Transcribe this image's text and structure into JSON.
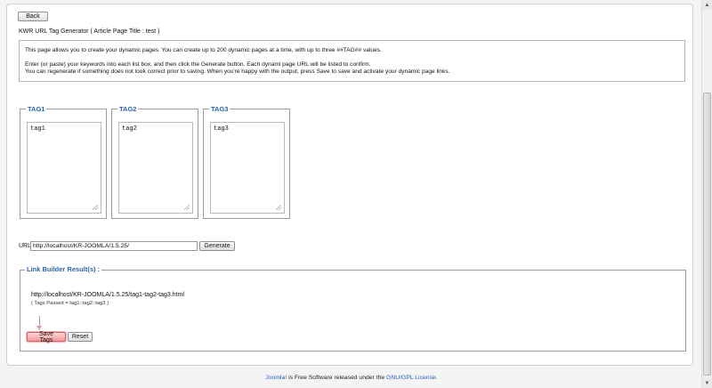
{
  "toolbar": {
    "back_label": "Back"
  },
  "page": {
    "title": "KWR URL Tag Generator ( Article Page Title : test )"
  },
  "info": {
    "line1": "This page allows you to create your dynamic pages. You can create up to 200 dynamic pages at a time, with up to three ##TAG## values.",
    "line2": "Enter (or paste) your keywords into each list box, and then click the Generate button. Each dynami page URL will be listed to confirm.",
    "line3": "You can regenerate if something does not look correct prior to saving. When you're happy with the output, press Save to save and activate your dynamic page links."
  },
  "tags": [
    {
      "legend": "TAG1",
      "value": "tag1"
    },
    {
      "legend": "TAG2",
      "value": "tag2"
    },
    {
      "legend": "TAG3",
      "value": "tag3"
    }
  ],
  "url": {
    "label": "URL",
    "value": "http://localhost/KR-JOOMLA/1.5.25/",
    "generate_label": "Generate"
  },
  "results": {
    "legend": "Link Builder Result(s) :",
    "link": "http://localhost/KR-JOOMLA/1.5.25/tag1-tag2-tag3.html",
    "tags_passed": "( Tags Passed = tag1::tag2::tag3 )",
    "save_label": "Save Tags",
    "reset_label": "Reset"
  },
  "footer": {
    "joomla_link": "Joomla!",
    "text": " is Free Software released under the ",
    "license_link": "GNU/GPL License",
    "end": "."
  },
  "icons": {
    "resize": "resize-grip-icon",
    "arrow": "arrow-down-icon",
    "scroll_up": "chevron-up-icon",
    "scroll_down": "chevron-down-icon"
  },
  "colors": {
    "legend": "#2a64b0",
    "link": "#1d5fbf",
    "save_highlight": "#f09a9a"
  }
}
